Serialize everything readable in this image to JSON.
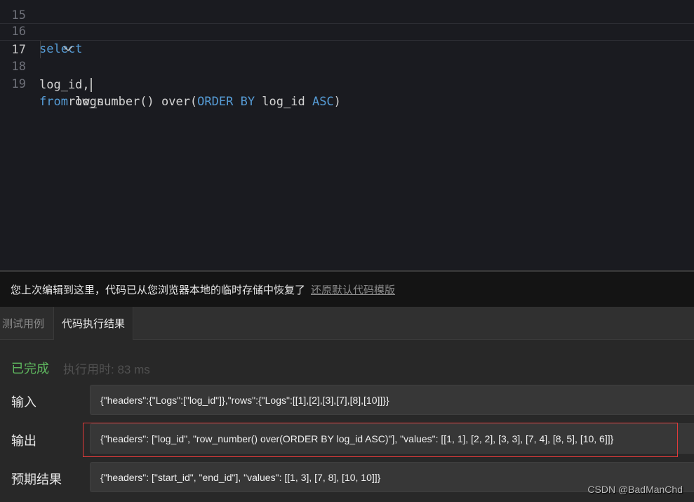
{
  "editor": {
    "partial_line_number": "15",
    "lines": [
      {
        "number": "16",
        "segments": [
          {
            "text": "select",
            "kw": true
          }
        ]
      },
      {
        "number": "17",
        "segments": [
          {
            "text": "log_id,",
            "kw": false
          }
        ]
      },
      {
        "number": "18",
        "segments": [
          {
            "text": "    row_number() over(",
            "kw": false
          },
          {
            "text": "ORDER BY",
            "kw": true
          },
          {
            "text": " log_id ",
            "kw": false
          },
          {
            "text": "ASC",
            "kw": true
          },
          {
            "text": ")",
            "kw": false
          }
        ]
      },
      {
        "number": "19",
        "segments": [
          {
            "text": "from",
            "kw": true
          },
          {
            "text": " logs",
            "kw": false
          }
        ]
      }
    ],
    "fold_icon": "chevron-down-icon"
  },
  "notice": {
    "text": "您上次编辑到这里，代码已从您浏览器本地的临时存储中恢复了",
    "link": "还原默认代码模版"
  },
  "tabs": [
    {
      "label": "测试用例",
      "active": false
    },
    {
      "label": "代码执行结果",
      "active": true
    }
  ],
  "result": {
    "status": "已完成",
    "time_label": "执行用时:",
    "time_value": "83 ms",
    "input_label": "输入",
    "input_value": "{\"headers\":{\"Logs\":[\"log_id\"]},\"rows\":{\"Logs\":[[1],[2],[3],[7],[8],[10]]}}",
    "output_label": "输出",
    "output_value": "{\"headers\": [\"log_id\", \"row_number() over(ORDER BY log_id ASC)\"], \"values\": [[1, 1], [2, 2], [3, 3], [7, 4], [8, 5], [10, 6]]}",
    "expected_label": "预期结果",
    "expected_value": "{\"headers\": [\"start_id\", \"end_id\"], \"values\": [[1, 3], [7, 8], [10, 10]]}"
  },
  "watermark": "CSDN @BadManChd",
  "colors": {
    "keyword": "#569cd6",
    "status_done": "#5fb85f",
    "highlight_border": "#e03a3a"
  }
}
